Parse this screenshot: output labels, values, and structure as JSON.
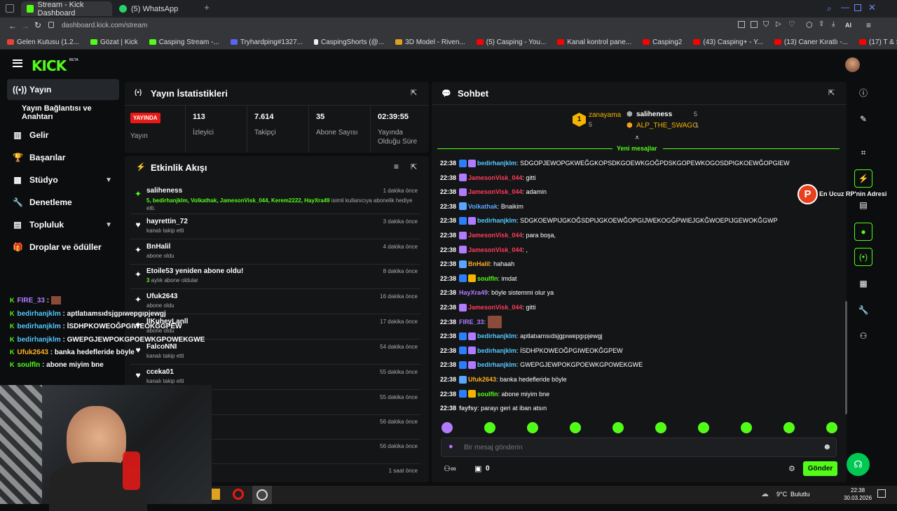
{
  "browser": {
    "tabs": [
      {
        "label": "Stream - Kick Dashboard"
      },
      {
        "label": "(5) WhatsApp"
      }
    ],
    "new_tab": "+",
    "url": "dashboard.kick.com/stream",
    "ai_label": "AI",
    "bookmarks": [
      "Gelen Kutusu (1.2...",
      "Gözat | Kick",
      "Casping Stream -...",
      "Tryhardping#1327...",
      "CaspingShorts (@...",
      "3D Model - Riven...",
      "(5) Casping - You...",
      "Kanal kontrol pane...",
      "Casping2",
      "(43) Casping+ - Y...",
      "(13) Caner Kıratlı -...",
      "(17) T & Sugah - In..."
    ]
  },
  "brand": {
    "logo": "KICK",
    "beta": "BETA",
    "accent": "#53fc18"
  },
  "sidebar": {
    "items": [
      {
        "label": "Yayın"
      },
      {
        "label": "Yayın Bağlantısı ve Anahtarı"
      },
      {
        "label": "Gelir"
      },
      {
        "label": "Başarılar"
      },
      {
        "label": "Stüdyo"
      },
      {
        "label": "Denetleme"
      },
      {
        "label": "Topluluk"
      },
      {
        "label": "Droplar ve ödüller"
      }
    ]
  },
  "stats": {
    "title": "Yayın İstatistikleri",
    "live_badge": "YAYINDA",
    "live_label": "Yayın",
    "items": [
      {
        "value": "113",
        "label": "İzleyici"
      },
      {
        "value": "7.614",
        "label": "Takipçi"
      },
      {
        "value": "35",
        "label": "Abone Sayısı"
      },
      {
        "value": "02:39:55",
        "label": "Yayında Olduğu Süre"
      }
    ]
  },
  "activity": {
    "title": "Etkinlik Akışı",
    "events": [
      {
        "name": "saliheness",
        "time": "1 dakika önce",
        "desc": "5, bedirhanjklm, Volkathak, JamesonVisk_044, Kerem2222, HayXra49",
        "desc_rest": " isimli kullanıcıya abonelik hediye etti."
      },
      {
        "name": "hayrettin_72",
        "time": "3 dakika önce",
        "desc": "kanalı takip etti"
      },
      {
        "name": "BnHalil",
        "time": "4 dakika önce",
        "desc": "abone oldu"
      },
      {
        "name": "Etoile53 yeniden abone oldu!",
        "time": "8 dakika önce",
        "desc": "3",
        "desc_rest": " aylık abone oldular"
      },
      {
        "name": "Ufuk2643",
        "time": "16 dakika önce",
        "desc": "abone oldu"
      },
      {
        "name": "lIKuheyLanll",
        "time": "17 dakika önce",
        "desc": "abone oldu"
      },
      {
        "name": "FalcoNNI",
        "time": "54 dakika önce",
        "desc": "kanalı takip etti"
      },
      {
        "name": "cceka01",
        "time": "55 dakika önce",
        "desc": "kanalı takip etti"
      },
      {
        "name": "",
        "time": "55 dakika önce",
        "desc": ""
      },
      {
        "name": "",
        "time": "56 dakika önce",
        "desc": ""
      },
      {
        "name": "",
        "time": "56 dakika önce",
        "desc": ""
      },
      {
        "name": "",
        "time": "1 saat önce",
        "desc": ""
      }
    ]
  },
  "chat": {
    "title": "Sohbet",
    "gifters": [
      {
        "rank": "1",
        "name": "zanayama",
        "count": "5"
      },
      {
        "name": "saliheness",
        "count": "5"
      },
      {
        "name": "ALP_THE_SWAGG",
        "count": "1"
      }
    ],
    "new_messages": "Yeni mesajlar",
    "messages": [
      {
        "time": "22:38",
        "user": "bedirhanjklm",
        "color": "#53c8ff",
        "text": "SDGOPJEWOPGKWEĞGKOPSDKGOEWKGOĞPDSKGOPEWKOGOSDPIGKOEWĞOPGIEW"
      },
      {
        "time": "22:38",
        "user": "JamesonVisk_044",
        "color": "#ff3b5c",
        "text": "gitti"
      },
      {
        "time": "22:38",
        "user": "JamesonVisk_044",
        "color": "#ff3b5c",
        "text": "adamin"
      },
      {
        "time": "22:38",
        "user": "Volkathak",
        "color": "#58a6ff",
        "text": "Bnaikim"
      },
      {
        "time": "22:38",
        "user": "bedirhanjklm",
        "color": "#53c8ff",
        "text": "SDGKOEWPIJGKOĞSDPIJGKOEWĞOPGIJWEKOGĞPWIEJGKĞWOEPIJGEWOKĞGWP"
      },
      {
        "time": "22:38",
        "user": "JamesonVisk_044",
        "color": "#ff3b5c",
        "text": "para boşa,"
      },
      {
        "time": "22:38",
        "user": "JamesonVisk_044",
        "color": "#ff3b5c",
        "text": ","
      },
      {
        "time": "22:38",
        "user": "BnHalil",
        "color": "#ffb020",
        "text": "hahaah"
      },
      {
        "time": "22:38",
        "user": "soulfln",
        "color": "#53fc18",
        "text": "imdat"
      },
      {
        "time": "22:38",
        "user": "HayXra49",
        "color": "#b07bff",
        "text": "böyle sistemmi olur ya"
      },
      {
        "time": "22:38",
        "user": "JamesonVisk_044",
        "color": "#ff3b5c",
        "text": "gitti"
      },
      {
        "time": "22:38",
        "user": "FIRE_33",
        "color": "#b07bff",
        "text": ""
      },
      {
        "time": "22:38",
        "user": "bedirhanjklm",
        "color": "#53c8ff",
        "text": "aptlatıamsıdsjgpıwepgıpjewgj"
      },
      {
        "time": "22:38",
        "user": "bedirhanjklm",
        "color": "#53c8ff",
        "text": "İSDHPKOWEOĞPGIWEOKĞGPEW"
      },
      {
        "time": "22:38",
        "user": "bedirhanjklm",
        "color": "#53c8ff",
        "text": "GWEPGJEWPOKGPOEWKGPOWEKGWE"
      },
      {
        "time": "22:38",
        "user": "Ufuk2643",
        "color": "#ffb020",
        "text": "banka hedefleride böyle"
      },
      {
        "time": "22:38",
        "user": "soulfln",
        "color": "#53fc18",
        "text": "abone miyim bne"
      },
      {
        "time": "22:38",
        "user": "fayfsy",
        "color": "#dddddd",
        "text": "parayı geri at iban atsın"
      }
    ],
    "placeholder": "Bir mesaj gönderin",
    "send": "Gönder",
    "points": "0"
  },
  "overlay": {
    "ad_text": "En Ucuz RP'nin Adresi",
    "lines": [
      {
        "user": "FIRE_33",
        "color": "#b07bff",
        "text": ""
      },
      {
        "user": "bedirhanjklm",
        "color": "#53c8ff",
        "text": "aptlatıamsıdsjgpıwepgıpjewgj"
      },
      {
        "user": "bedirhanjklm",
        "color": "#53c8ff",
        "text": "İSDHPKOWEOĞPGIWEOKĞGPEW"
      },
      {
        "user": "bedirhanjklm",
        "color": "#53c8ff",
        "text": "GWEPGJEWPOKGPOEWKGPOWEKGWE"
      },
      {
        "user": "Ufuk2643",
        "color": "#ffb020",
        "text": "banka hedefleride böyle"
      },
      {
        "user": "soulfln",
        "color": "#53fc18",
        "text": "abone miyim bne"
      }
    ]
  },
  "taskbar": {
    "weather": "9°C",
    "weather_desc": "Bulutlu",
    "time": "22:38",
    "date": "30.03.2026"
  }
}
